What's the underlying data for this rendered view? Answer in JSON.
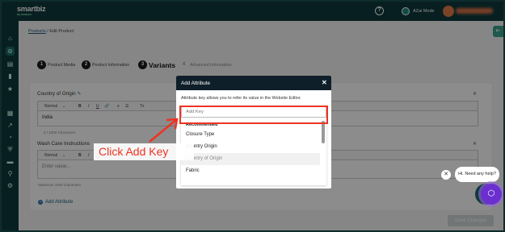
{
  "app": {
    "logo_text": "smartbiz",
    "logo_sub": "by amazon"
  },
  "topbar": {
    "help_icon": "question-circle-icon",
    "ai_mode_label": "AZai Mode"
  },
  "breadcrumb": {
    "parent": "Products",
    "separator": "/",
    "current": "Edit Product"
  },
  "steps": [
    {
      "num": "1",
      "label": "Product Media"
    },
    {
      "num": "2",
      "label": "Product Information"
    },
    {
      "num": "3",
      "label": "Variants"
    },
    {
      "num": "4",
      "label": "Advanced Information"
    }
  ],
  "attributes": [
    {
      "label": "Country of Origin",
      "toolbar": {
        "format": "Normal",
        "bold": "B",
        "italic": "I",
        "underline": "U",
        "link": "🔗",
        "olist": "≡",
        "ulist": "☰",
        "clear": "Tx"
      },
      "value": "India",
      "counter": "5 / 1000 Characters"
    },
    {
      "label": "Wash Care Instructions",
      "toolbar": {
        "format": "Normal",
        "bold": "B",
        "italic": "I",
        "underline": "U",
        "link": "🔗",
        "olist": "≡",
        "ulist": "☰",
        "clear": "Tx"
      },
      "placeholder": "Enter value...",
      "counter": "Maximum 1000 characters"
    }
  ],
  "add_attribute_label": "Add Attribute",
  "save_button": "Save Changes",
  "modal": {
    "title": "Add Attribute",
    "close": "✕",
    "description": "Attribute key allows you to refer its value in the Website Editor.",
    "input_placeholder": "Add Key",
    "dropdown_header": "Recommended",
    "options": [
      "Closure Type",
      "Country Origin",
      "Country of Origin",
      "Fabric"
    ]
  },
  "annotation": {
    "callout": "Click Add Key",
    "color": "#ee3322"
  },
  "chat": {
    "close": "✕",
    "greeting": "Hi. Need any help?"
  }
}
